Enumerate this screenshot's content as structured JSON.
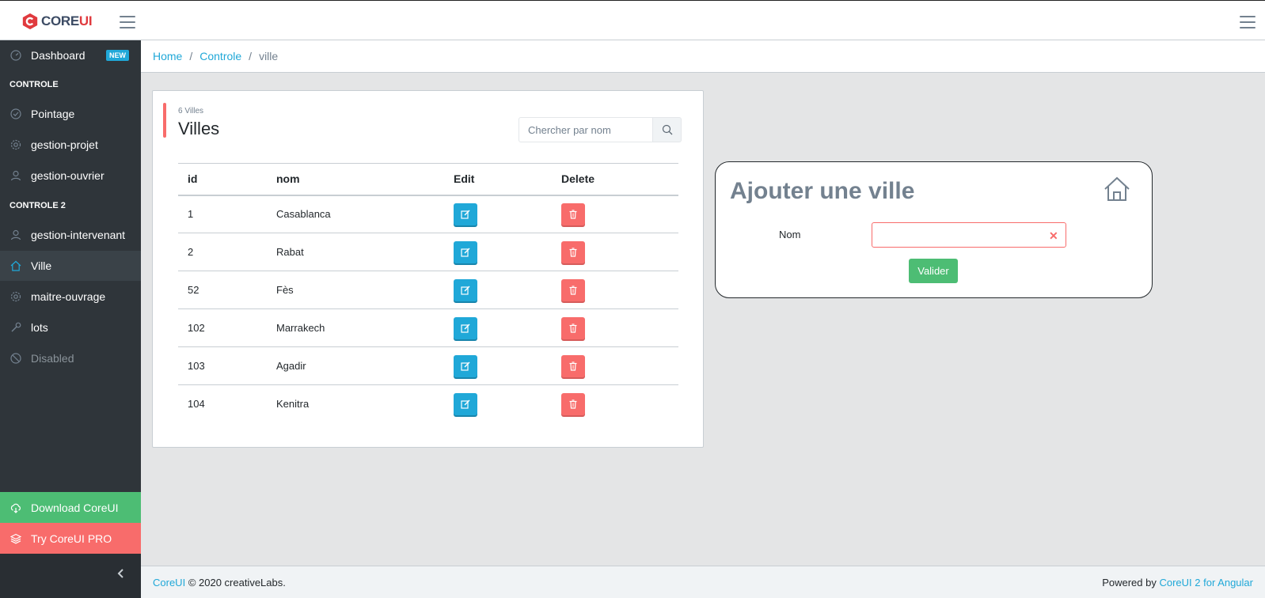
{
  "header": {
    "brand_core": "CORE",
    "brand_ui": "UI",
    "left_toggler_icon": "hamburger-icon",
    "right_toggler_icon": "hamburger-icon"
  },
  "sidebar": {
    "dashboard": {
      "label": "Dashboard",
      "badge": "NEW",
      "icon": "speedometer-icon"
    },
    "section1": "CONTROLE",
    "pointage": {
      "label": "Pointage",
      "icon": "check-icon"
    },
    "gestion_projet": {
      "label": "gestion-projet",
      "icon": "settings-icon"
    },
    "gestion_ouvrier": {
      "label": "gestion-ouvrier",
      "icon": "user-icon"
    },
    "section2": "CONTROLE 2",
    "gestion_intervenant": {
      "label": "gestion-intervenant",
      "icon": "user-icon"
    },
    "ville": {
      "label": "Ville",
      "icon": "home-icon"
    },
    "maitre_ouvrage": {
      "label": "maitre-ouvrage",
      "icon": "settings-icon"
    },
    "lots": {
      "label": "lots",
      "icon": "wrench-icon"
    },
    "disabled": {
      "label": "Disabled",
      "icon": "ban-icon"
    },
    "download": {
      "label": "Download CoreUI",
      "icon": "cloud-download-icon"
    },
    "try_pro": {
      "label": "Try CoreUI PRO",
      "icon": "layers-icon"
    }
  },
  "breadcrumb": {
    "home": "Home",
    "controle": "Controle",
    "current": "ville",
    "sep": "/"
  },
  "villes_card": {
    "count_label": "6 Villes",
    "title": "Villes",
    "search_placeholder": "Chercher par nom",
    "columns": {
      "id": "id",
      "nom": "nom",
      "edit": "Edit",
      "delete": "Delete"
    },
    "rows": [
      {
        "id": "1",
        "nom": "Casablanca"
      },
      {
        "id": "2",
        "nom": "Rabat"
      },
      {
        "id": "52",
        "nom": "Fès"
      },
      {
        "id": "102",
        "nom": "Marrakech"
      },
      {
        "id": "103",
        "nom": "Agadir"
      },
      {
        "id": "104",
        "nom": "Kenitra"
      }
    ]
  },
  "ajouter_card": {
    "title": "Ajouter une ville",
    "nom_label": "Nom",
    "nom_value": "",
    "clear_symbol": "✕",
    "submit": "Valider"
  },
  "footer": {
    "brand_link": "CoreUI",
    "copyright": "© 2020 creativeLabs.",
    "powered_by": "Powered by",
    "powered_link": "CoreUI 2 for Angular"
  },
  "colors": {
    "primary": "#20a8d8",
    "success": "#4dbd74",
    "danger": "#f86c6b",
    "sidebar_bg": "#2f353a"
  }
}
